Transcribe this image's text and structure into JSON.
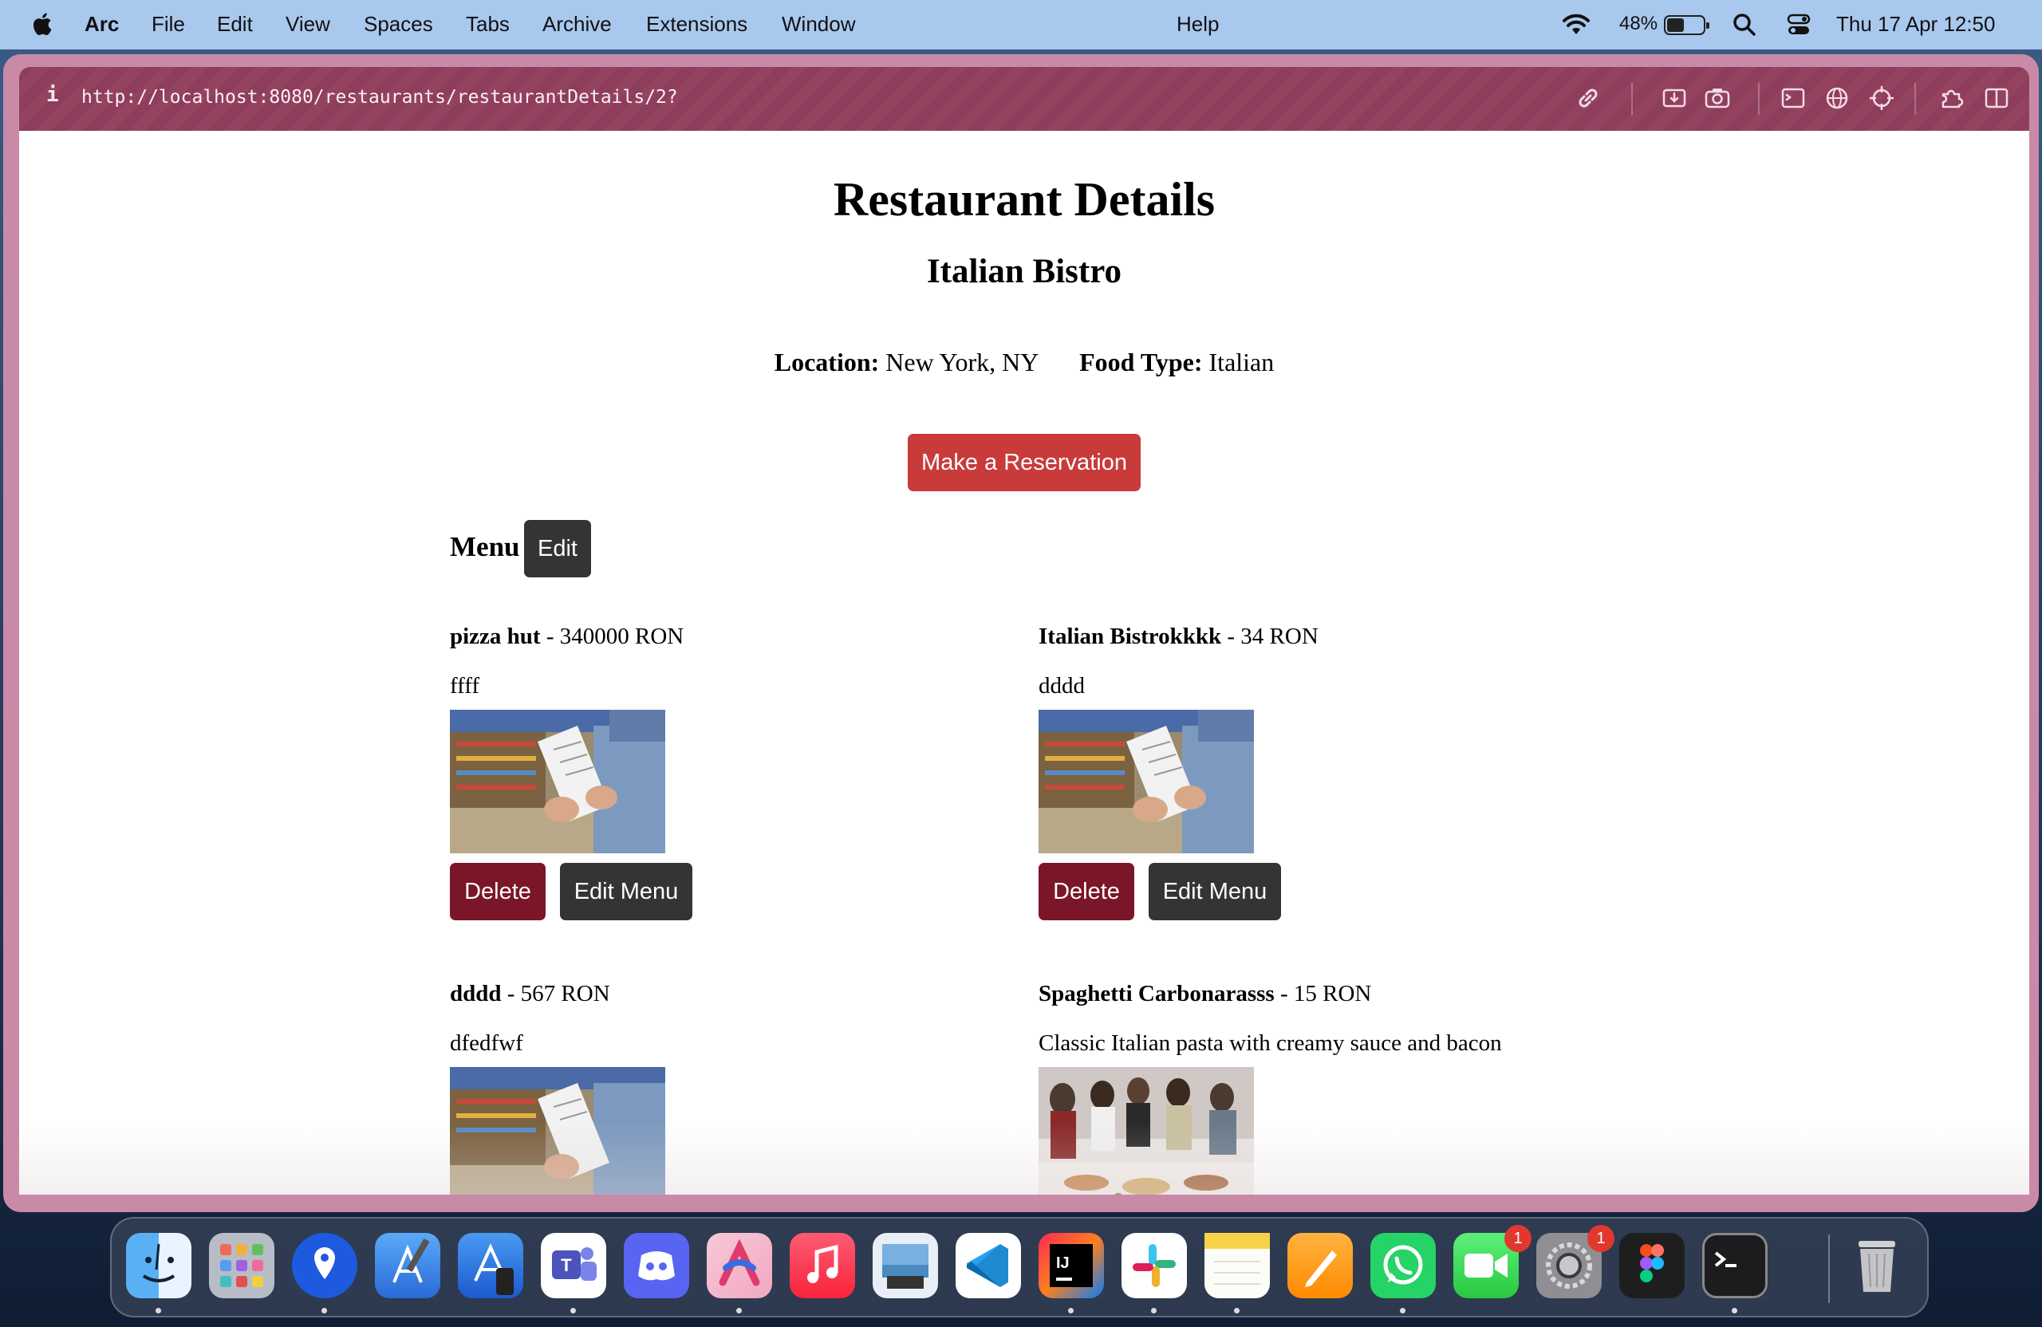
{
  "menubar": {
    "app_name": "Arc",
    "items": [
      "File",
      "Edit",
      "View",
      "Spaces",
      "Tabs",
      "Archive",
      "Extensions",
      "Window"
    ],
    "help": "Help",
    "battery_percent": "48%",
    "datetime": "Thu 17 Apr  12:50"
  },
  "browser": {
    "info_icon": "i",
    "url": "http://localhost:8080/restaurants/restaurantDetails/2?",
    "toolbar_icons": [
      "link-icon",
      "download-icon",
      "camera-icon",
      "terminal-icon",
      "globe-icon",
      "crosshair-icon",
      "extensions-icon",
      "sidebar-icon"
    ]
  },
  "page": {
    "title": "Restaurant Details",
    "restaurant_name": "Italian Bistro",
    "location_label": "Location:",
    "location": "New York, NY",
    "food_type_label": "Food Type:",
    "food_type": "Italian",
    "reserve_button": "Make a Reservation",
    "menu_heading": "Menu",
    "edit_button": "Edit",
    "delete_label": "Delete",
    "edit_menu_label": "Edit Menu",
    "items": [
      {
        "name": "pizza hut",
        "price": " - 340000 RON",
        "description": "ffff",
        "image": "grocery-receipt-photo"
      },
      {
        "name": "Italian Bistrokkkk",
        "price": " - 34 RON",
        "description": "dddd",
        "image": "grocery-receipt-photo"
      },
      {
        "name": "dddd",
        "price": " - 567 RON",
        "description": "dfedfwf",
        "image": "grocery-receipt-photo"
      },
      {
        "name": "Spaghetti Carbonarasss",
        "price": " - 15 RON",
        "description": "Classic Italian pasta with creamy sauce and bacon",
        "image": "buffet-party-photo"
      }
    ]
  },
  "dock": {
    "apps": [
      "Finder",
      "Launchpad",
      "Pin app",
      "Xcode",
      "Simulator",
      "Microsoft Teams",
      "Discord",
      "Arc",
      "Music",
      "Preview",
      "Visual Studio Code",
      "IntelliJ IDEA",
      "Slack",
      "Notes",
      "Pages",
      "WhatsApp",
      "FaceTime",
      "System Settings",
      "Figma",
      "Terminal",
      "Trash"
    ],
    "facetime_badge": "1",
    "settings_badge": "1"
  }
}
